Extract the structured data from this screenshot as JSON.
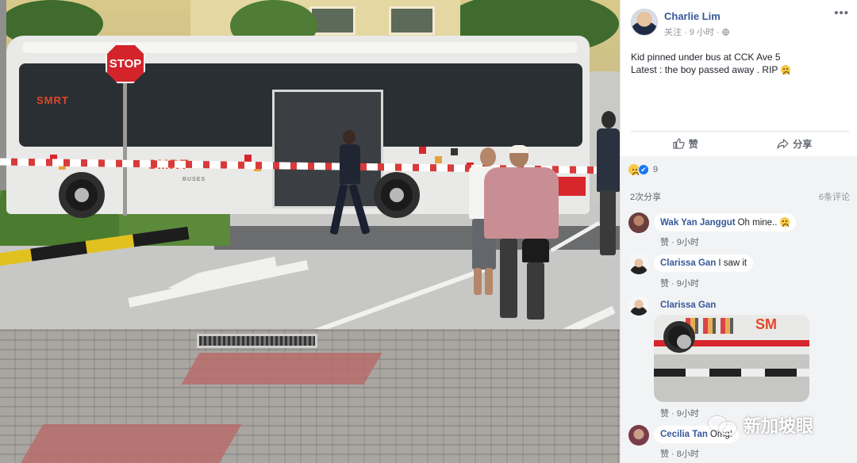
{
  "photo": {
    "stop_sign": "STOP",
    "bus_logo_front": "SMRT",
    "bus_logo_side": "SMRT",
    "bus_logo_sub": "BUSES"
  },
  "post": {
    "author": "Charlie Lim",
    "follow": "关注",
    "time": "9 小时",
    "privacy_icon": "globe-icon",
    "more_icon": "ellipsis-icon",
    "text": "Kid pinned under bus at CCK Ave 5\nLatest : the boy passed away . RIP",
    "actions": {
      "like": "赞",
      "share": "分享"
    },
    "reactions_count": "9",
    "shares": "2次分享",
    "comments_count": "6条评论"
  },
  "comments": [
    {
      "author": "Wak Yan Janggut",
      "text": "Oh mine..",
      "like": "赞",
      "time": "9小时"
    },
    {
      "author": "Clarissa Gan",
      "text": "I saw it",
      "like": "赞",
      "time": "9小时"
    },
    {
      "author": "Clarissa Gan",
      "text": "",
      "attachment_logo": "SM",
      "like": "赞",
      "time": "9小时"
    },
    {
      "author": "Cecilia Tan",
      "text": "Omg!",
      "like": "赞",
      "time": "8小时"
    }
  ],
  "watermark": "新加坡眼",
  "colors": {
    "link_blue": "#365899",
    "comment_bg": "#f2f3f5",
    "bus_red": "#d8262d"
  }
}
